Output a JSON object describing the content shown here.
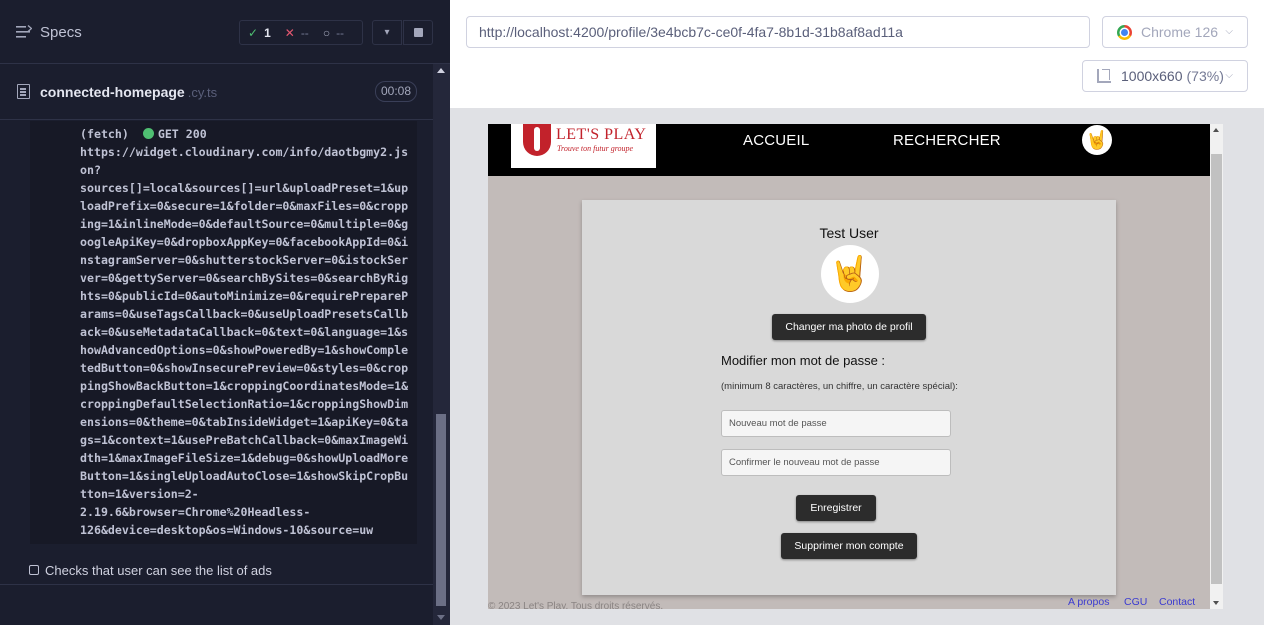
{
  "reporter": {
    "specs_label": "Specs",
    "stats": {
      "passed": "1",
      "failed": "--",
      "pending": "--"
    },
    "file": {
      "name": "connected-homepage",
      "ext": ".cy.ts",
      "duration": "00:08"
    },
    "log": {
      "fetch_prefix": "(fetch)",
      "method_status": "GET 200",
      "lines": [
        "https://widget.cloudinary.com/info/daotbgmy2.js",
        "on?",
        "sources[]=local&sources[]=url&uploadPreset=1&up",
        "loadPrefix=0&secure=1&folder=0&maxFiles=0&cropp",
        "ing=1&inlineMode=0&defaultSource=0&multiple=0&g",
        "oogleApiKey=0&dropboxAppKey=0&facebookAppId=0&i",
        "nstagramServer=0&shutterstockServer=0&istockSer",
        "ver=0&gettyServer=0&searchBySites=0&searchByRig",
        "hts=0&publicId=0&autoMinimize=0&requirePrepareP",
        "arams=0&useTagsCallback=0&useUploadPresetsCallb",
        "ack=0&useMetadataCallback=0&text=0&language=1&s",
        "howAdvancedOptions=0&showPoweredBy=1&showComple",
        "tedButton=0&showInsecurePreview=0&styles=0&crop",
        "pingShowBackButton=1&croppingCoordinatesMode=1&",
        "croppingDefaultSelectionRatio=1&croppingShowDim",
        "ensions=0&theme=0&tabInsideWidget=1&apiKey=0&ta",
        "gs=1&context=1&usePreBatchCallback=0&maxImageWi",
        "dth=1&maxImageFileSize=1&debug=0&showUploadMore",
        "Button=1&singleUploadAutoClose=1&showSkipCropBu",
        "tton=1&version=2-",
        "2.19.6&browser=Chrome%20Headless-",
        "126&device=desktop&os=Windows-10&source=uw"
      ]
    },
    "test_title": "Checks that user can see the list of ads"
  },
  "aut": {
    "url": "http://localhost:4200/profile/3e4bcb7c-ce0f-4fa7-8b1d-31b8af8ad11a",
    "browser": "Chrome 126",
    "viewport": "1000x660",
    "zoom": "(73%)"
  },
  "app": {
    "logo_title": "LET'S PLAY",
    "logo_subtitle": "Trouve ton futur groupe",
    "nav": {
      "home": "ACCUEIL",
      "search": "RECHERCHER"
    },
    "profile": {
      "name": "Test User",
      "change_photo": "Changer ma photo de profil",
      "password_title": "Modifier mon mot de passe :",
      "password_hint": "(minimum 8 caractères, un chiffre, un caractère spécial):",
      "new_password_placeholder": "Nouveau mot de passe",
      "confirm_password_placeholder": "Confirmer le nouveau mot de passe",
      "save": "Enregistrer",
      "delete_account": "Supprimer mon compte"
    },
    "footer": {
      "copyright": "© 2023 Let's Play. Tous droits réservés.",
      "links": [
        "A propos",
        "CGU",
        "Contact"
      ]
    }
  },
  "colors": {
    "reporter_bg": "#1b1e2e",
    "pass": "#4fbf72",
    "fail": "#e45770",
    "app_brand": "#c2222b",
    "button_dark": "#2c2c2c",
    "link": "#3b3bd0"
  },
  "icons": [
    "specs-list-icon",
    "check-icon",
    "x-icon",
    "spinner-icon",
    "chevron-down-icon",
    "stop-icon",
    "file-icon",
    "chrome-icon",
    "ruler-icon",
    "rock-hand-icon"
  ]
}
